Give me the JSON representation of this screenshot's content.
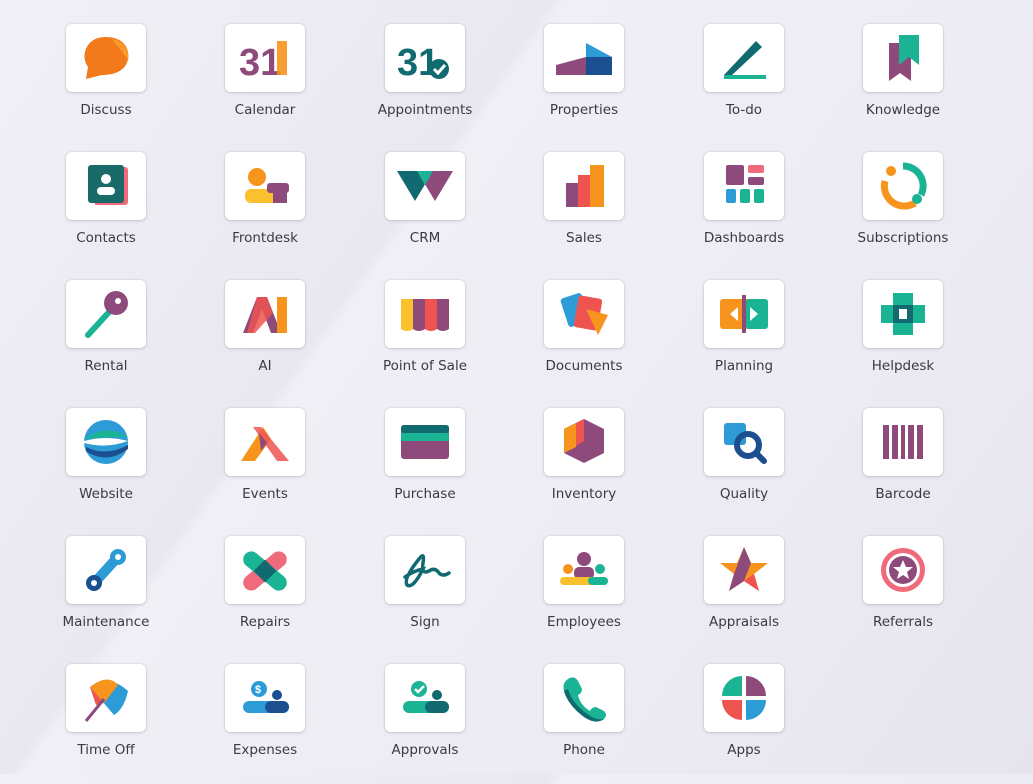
{
  "apps": {
    "discuss": "Discuss",
    "calendar": "Calendar",
    "appointments": "Appointments",
    "properties": "Properties",
    "todo": "To-do",
    "knowledge": "Knowledge",
    "contacts": "Contacts",
    "frontdesk": "Frontdesk",
    "crm": "CRM",
    "sales": "Sales",
    "dashboards": "Dashboards",
    "subscriptions": "Subscriptions",
    "rental": "Rental",
    "ai": "AI",
    "pos": "Point of Sale",
    "documents": "Documents",
    "planning": "Planning",
    "helpdesk": "Helpdesk",
    "website": "Website",
    "events": "Events",
    "purchase": "Purchase",
    "inventory": "Inventory",
    "quality": "Quality",
    "barcode": "Barcode",
    "maintenance": "Maintenance",
    "repairs": "Repairs",
    "sign": "Sign",
    "employees": "Employees",
    "appraisals": "Appraisals",
    "referrals": "Referrals",
    "timeoff": "Time Off",
    "expenses": "Expenses",
    "approvals": "Approvals",
    "phone": "Phone",
    "apps": "Apps"
  },
  "icon_glyphs": {
    "calendar": "31",
    "appointments": "31",
    "ai": "AI"
  },
  "colors": {
    "orange": "#f7941d",
    "purple": "#8f4a7c",
    "teal": "#1ab394",
    "blue": "#2d9bd6",
    "navy": "#1c4f8f",
    "red": "#ef5350",
    "yellow": "#fbc02d",
    "dark_teal": "#116a70"
  }
}
